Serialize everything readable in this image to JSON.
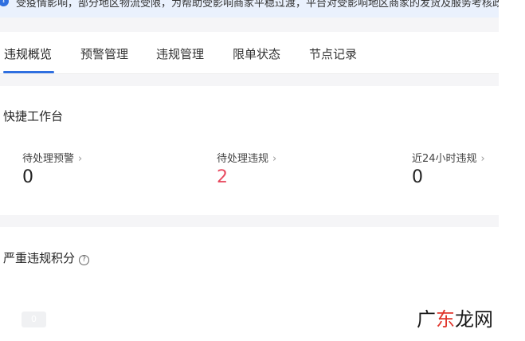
{
  "notice": {
    "text": "受疫情影响，部分地区物流受限，为帮助受影响商家平稳过渡，平台对受影响地区商家的发货及服务考核政策进行调"
  },
  "tabs": [
    {
      "label": "违规概览",
      "active": true
    },
    {
      "label": "预警管理"
    },
    {
      "label": "违规管理"
    },
    {
      "label": "限单状态"
    },
    {
      "label": "节点记录"
    }
  ],
  "quick": {
    "title": "快捷工作台",
    "metrics": [
      {
        "label": "待处理预警",
        "value": "0"
      },
      {
        "label": "待处理违规",
        "value": "2"
      },
      {
        "label": "近24小时违规",
        "value": "0"
      }
    ]
  },
  "score": {
    "title": "严重违规积分",
    "chip_value": "0"
  },
  "watermark": {
    "text_dark_1": "广",
    "text_accent": "东",
    "text_dark_2": "龙网"
  },
  "colors": {
    "accent": "#2f6fe0",
    "alert": "#e84a5f",
    "notice_bg": "#eaf1fd",
    "page_gap": "#f5f5f7"
  }
}
